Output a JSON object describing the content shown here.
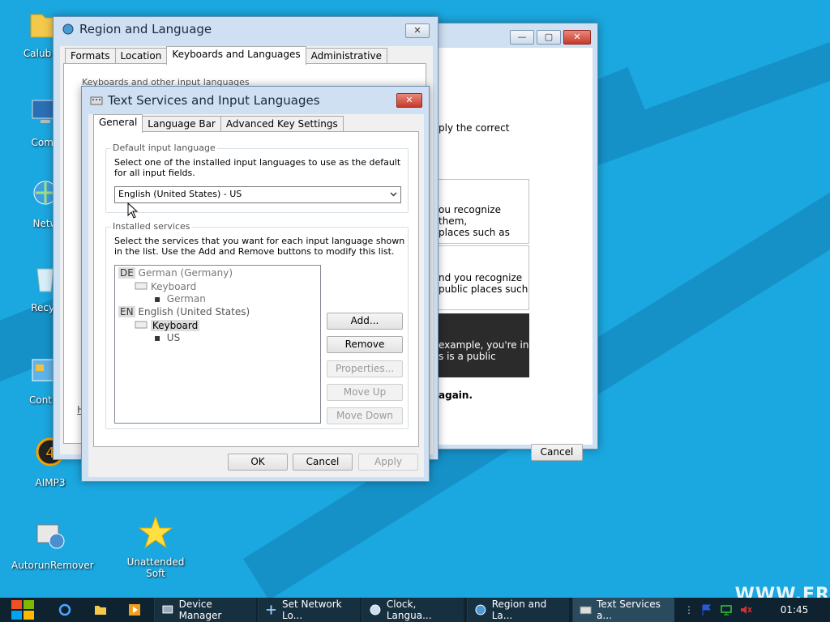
{
  "desktop": {
    "icons": [
      {
        "label": "Calub VK",
        "icon": "folder-icon"
      },
      {
        "label": "Comp",
        "icon": "computer-icon"
      },
      {
        "label": "Netw",
        "icon": "network-icon"
      },
      {
        "label": "Recyc",
        "icon": "recycle-bin-icon"
      },
      {
        "label": "Contro",
        "icon": "control-panel-icon"
      },
      {
        "label": "AIMP3",
        "icon": "aimp-icon"
      },
      {
        "label": "AutorunRemover",
        "icon": "autorun-remover-icon"
      },
      {
        "label": "Unattended Soft",
        "icon": "star-icon"
      }
    ],
    "watermark": "WWW.FR"
  },
  "back_window": {
    "texts": [
      "ply the correct",
      "ou recognize them,",
      " places such as",
      "nd you recognize",
      "public places such",
      " example, you're in",
      "s is a public",
      "again."
    ],
    "cancel_label": "Cancel"
  },
  "region_window": {
    "title": "Region and Language",
    "tabs": [
      "Formats",
      "Location",
      "Keyboards and Languages",
      "Administrative"
    ],
    "active_tab": "Keyboards and Languages",
    "group_label": "Keyboards and other input languages",
    "link_fragment": "H"
  },
  "text_services": {
    "title": "Text Services and Input Languages",
    "tabs": [
      "General",
      "Language Bar",
      "Advanced Key Settings"
    ],
    "default_group": {
      "label": "Default input language",
      "description": "Select one of the installed input languages to use as the default for all input fields.",
      "selected": "English (United States) - US"
    },
    "installed_group": {
      "label": "Installed services",
      "description": "Select the services that you want for each input language shown in the list. Use the Add and Remove buttons to modify this list.",
      "tree": {
        "lang1_code": "DE",
        "lang1_name": "German (Germany)",
        "lang1_cat": "Keyboard",
        "lang1_item": "German",
        "lang2_code": "EN",
        "lang2_name": "English (United States)",
        "lang2_cat": "Keyboard",
        "lang2_item": "US"
      },
      "buttons": {
        "add": "Add...",
        "remove": "Remove",
        "properties": "Properties...",
        "move_up": "Move Up",
        "move_down": "Move Down"
      }
    },
    "footer": {
      "ok": "OK",
      "cancel": "Cancel",
      "apply": "Apply"
    }
  },
  "taskbar": {
    "items": [
      "Device Manager",
      "Set Network Lo...",
      "Clock, Langua...",
      "Region and La...",
      "Text Services a..."
    ],
    "clock": "01:45"
  }
}
